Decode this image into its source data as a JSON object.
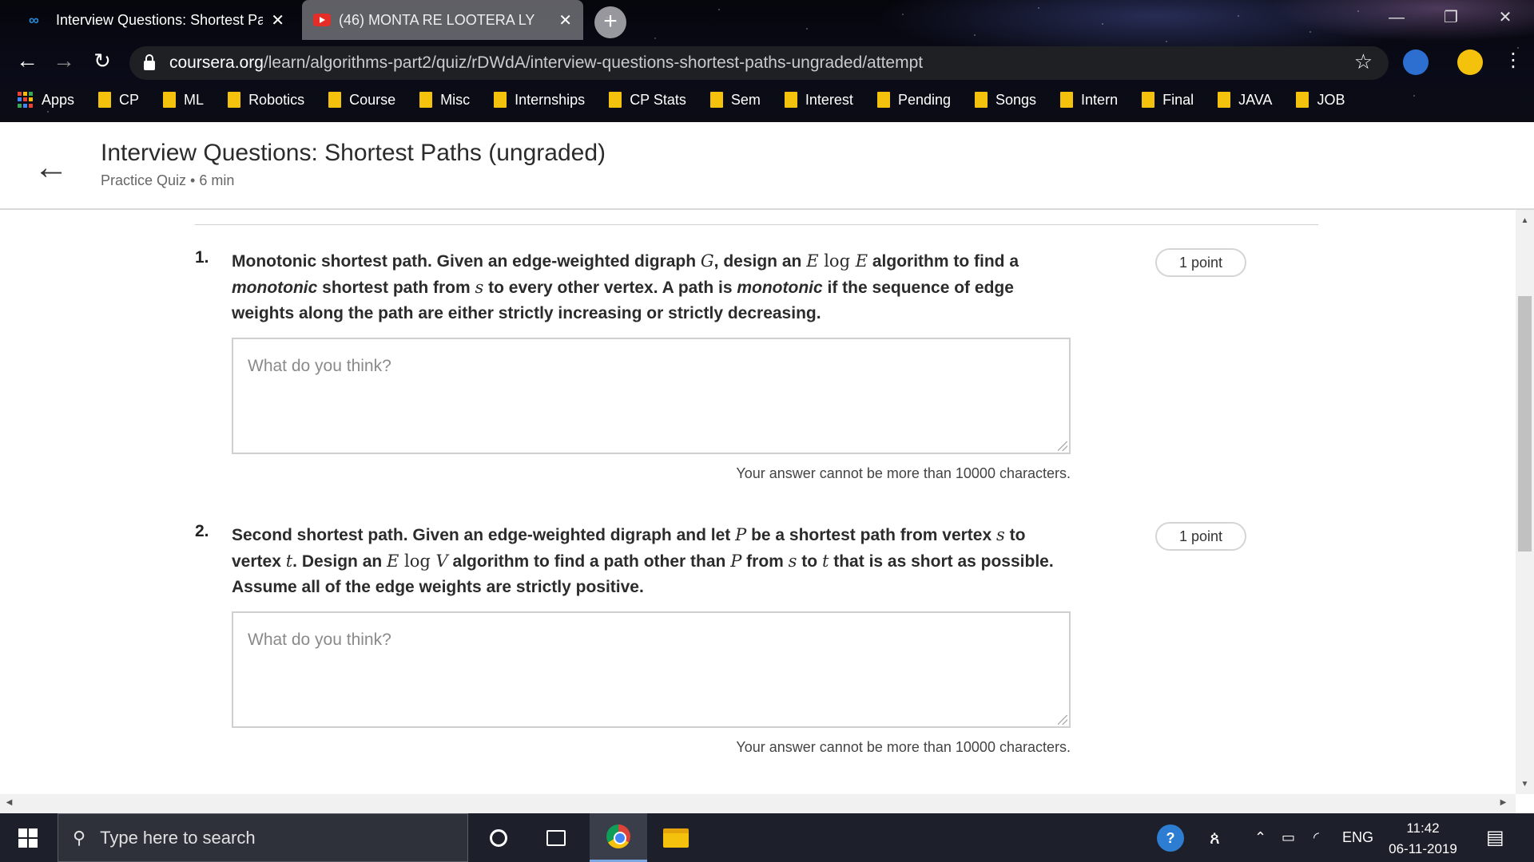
{
  "browser": {
    "tabs": [
      {
        "title": "Interview Questions: Shortest Pat",
        "active": true,
        "icon": "coursera-icon"
      },
      {
        "title": "(46) MONTA RE LOOTERA LY",
        "active": false,
        "icon": "youtube-icon"
      }
    ],
    "url_host": "coursera.org",
    "url_path": "/learn/algorithms-part2/quiz/rDWdA/interview-questions-shortest-paths-ungraded/attempt",
    "bookmarks": [
      "Apps",
      "CP",
      "ML",
      "Robotics",
      "Course",
      "Misc",
      "Internships",
      "CP Stats",
      "Sem",
      "Interest",
      "Pending",
      "Songs",
      "Intern",
      "Final",
      "JAVA",
      "JOB"
    ]
  },
  "page": {
    "title": "Interview Questions: Shortest Paths (ungraded)",
    "subtitle": "Practice Quiz • 6 min"
  },
  "questions": [
    {
      "number": "1.",
      "points": "1 point",
      "placeholder": "What do you think?",
      "limit_note": "Your answer cannot be more than 10000 characters.",
      "parts": {
        "a": "Monotonic shortest path. Given an edge-weighted digraph ",
        "G": "G",
        "b": ", design an ",
        "E1": "E",
        "log": " log ",
        "E2": "E",
        "c": " algorithm to find a ",
        "mono1": "monotonic",
        "d": " shortest path from ",
        "s": "s",
        "e": " to every other vertex. A path is ",
        "mono2": "monotonic",
        "f": " if the sequence of edge weights along the path are either strictly increasing or strictly decreasing."
      }
    },
    {
      "number": "2.",
      "points": "1 point",
      "placeholder": "What do you think?",
      "limit_note": "Your answer cannot be more than 10000 characters.",
      "parts": {
        "a": "Second shortest path. Given an edge-weighted digraph and let ",
        "P1": "P",
        "b": " be a shortest path from vertex ",
        "s1": "s",
        "c": " to vertex ",
        "t1": "t",
        "d": ". Design an ",
        "E": "E",
        "log": " log ",
        "V": "V",
        "e": " algorithm to find a path other than ",
        "P2": "P",
        "f": " from ",
        "s2": "s",
        "g": " to ",
        "t2": "t",
        "h": " that is as short as possible. Assume all of the edge weights are strictly positive."
      }
    }
  ],
  "taskbar": {
    "search_placeholder": "Type here to search",
    "lang": "ENG",
    "time": "11:42",
    "date": "06-11-2019"
  },
  "colors": {
    "accent_link": "#2b8ad8",
    "bookmark_folder": "#f4c20d"
  }
}
